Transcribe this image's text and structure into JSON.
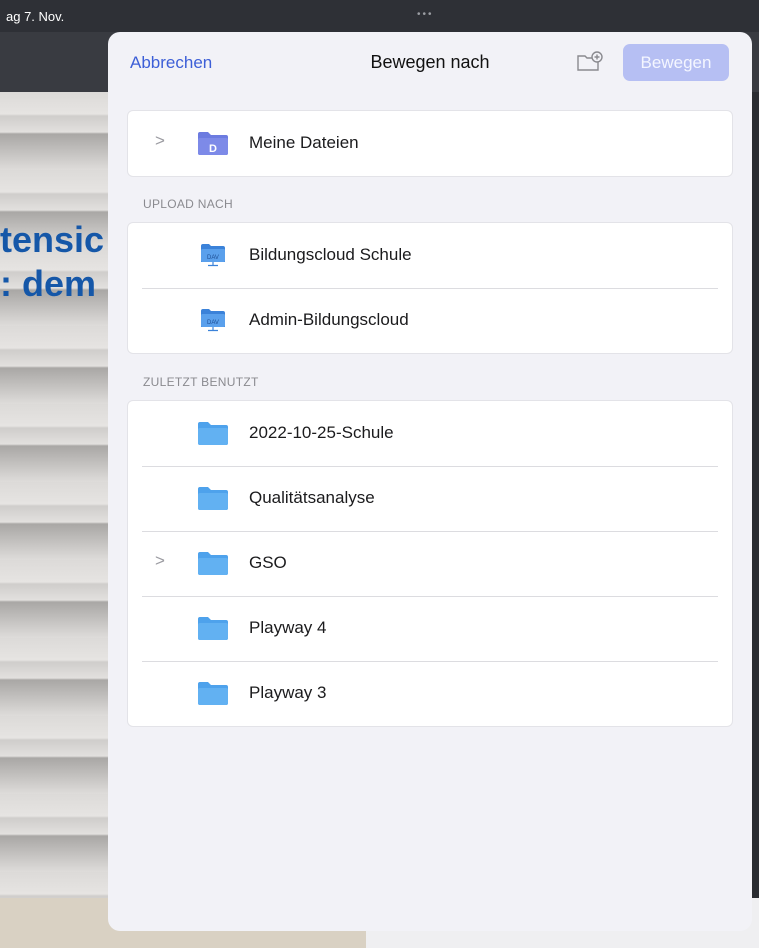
{
  "status": {
    "date": "ag 7. Nov.",
    "multitask_dots": "•••"
  },
  "background": {
    "promo_text_1": "tensic",
    "promo_text_2": ": dem"
  },
  "sheet": {
    "cancel_label": "Abbrechen",
    "title": "Bewegen nach",
    "move_label": "Bewegen",
    "my_files": {
      "label": "Meine Dateien",
      "badge": "D"
    },
    "upload_section_title": "UPLOAD NACH",
    "upload_items": [
      {
        "label": "Bildungscloud Schule",
        "badge": "DAV"
      },
      {
        "label": "Admin-Bildungscloud",
        "badge": "DAV"
      }
    ],
    "recent_section_title": "ZULETZT BENUTZT",
    "recent_items": [
      {
        "label": "2022-10-25-Schule",
        "expandable": false
      },
      {
        "label": "Qualitätsanalyse",
        "expandable": false
      },
      {
        "label": "GSO",
        "expandable": true
      },
      {
        "label": "Playway 4",
        "expandable": false
      },
      {
        "label": "Playway 3",
        "expandable": false
      }
    ]
  },
  "colors": {
    "accent": "#3d5fd7",
    "folder": "#5aa9ee",
    "my_files_folder": "#6c7be0",
    "dav_folder": "#4b8fe0"
  }
}
